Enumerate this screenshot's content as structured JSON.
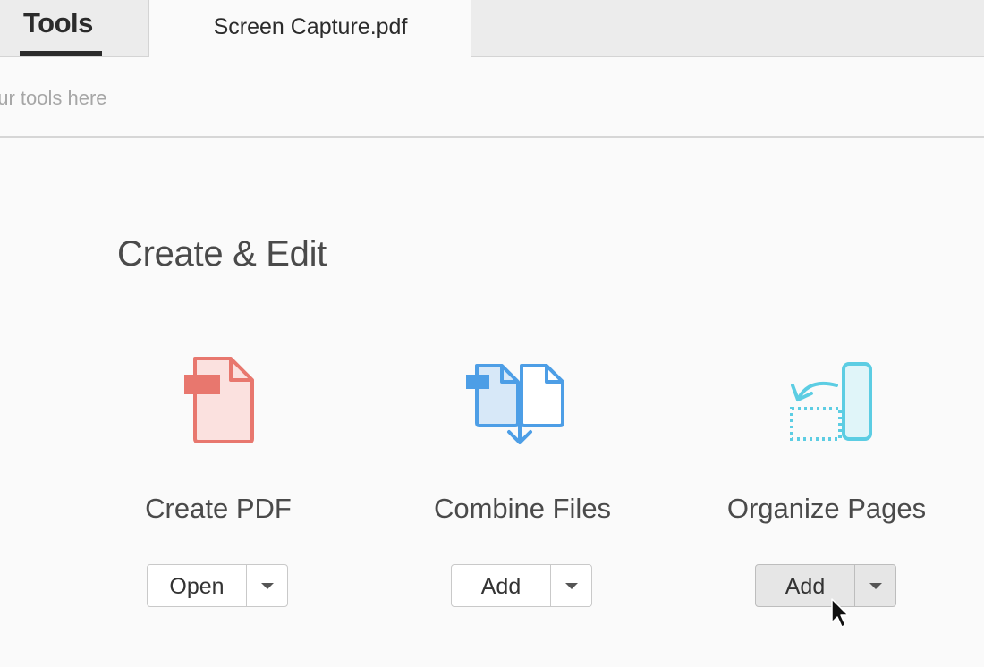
{
  "tabs": {
    "tools_label": "Tools",
    "document_label": "Screen Capture.pdf"
  },
  "search": {
    "placeholder": "your tools here",
    "value": ""
  },
  "section": {
    "title": "Create & Edit"
  },
  "tools": [
    {
      "label": "Create PDF",
      "button_label": "Open",
      "icon": "create-pdf-icon",
      "color": "#e8776e"
    },
    {
      "label": "Combine Files",
      "button_label": "Add",
      "icon": "combine-files-icon",
      "color": "#4d9ee6"
    },
    {
      "label": "Organize Pages",
      "button_label": "Add",
      "icon": "organize-pages-icon",
      "color": "#5ccde3"
    }
  ],
  "colors": {
    "create_pdf": "#e8776e",
    "combine_files": "#4d9ee6",
    "organize_pages": "#5ccde3",
    "text_dark": "#2b2b2b"
  }
}
